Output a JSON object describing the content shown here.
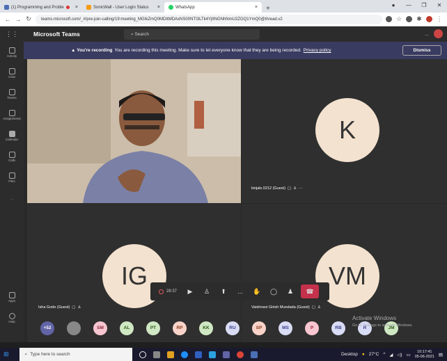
{
  "browser": {
    "tabs": [
      {
        "label": "(1) Programming and Proble",
        "active": false
      },
      {
        "label": "SonicWall - User Login Status",
        "active": false
      },
      {
        "label": "WhatsApp",
        "active": true
      }
    ],
    "new_tab": "+",
    "url": "teams.microsoft.com/_#/pre-join-calling/19:meeting_MGIkZmQ0MDItMDAxNS00NTI3LTk4YjItNGNhNmU2ZGQ1YmQ0@thread.v2"
  },
  "rail": [
    {
      "label": "Activity"
    },
    {
      "label": "Chat"
    },
    {
      "label": "Teams"
    },
    {
      "label": "Assignments"
    },
    {
      "label": "Calendar"
    },
    {
      "label": "Calls"
    },
    {
      "label": "Files"
    },
    {
      "label": "..."
    }
  ],
  "rail_bottom": [
    {
      "label": "Apps"
    },
    {
      "label": "Help"
    }
  ],
  "teams": {
    "title": "Microsoft Teams",
    "search_placeholder": "Search",
    "more": "..."
  },
  "banner": {
    "bold": "You're recording",
    "text": "You are recording this meeting. Make sure to let everyone know that they are being recorded.",
    "link": "Privacy policy",
    "dismiss": "Dismiss"
  },
  "participants": {
    "k": {
      "initials": "K",
      "name": "kinjals.0212 (Guest)"
    },
    "ig": {
      "initials": "IG",
      "name": "Isha Gode (Guest)"
    },
    "vm": {
      "initials": "VM",
      "name": "Vaishnavi Girish Mundada (Guest)"
    }
  },
  "toolbar": {
    "timer": "28:37",
    "more": "..."
  },
  "roster": [
    {
      "initials": "+52",
      "bg": "#6264a7",
      "fg": "#ffffff"
    },
    {
      "initials": "",
      "bg": "#888888",
      "fg": "#ffffff"
    },
    {
      "initials": "SM",
      "bg": "#f7c6d0",
      "fg": "#8a2a3a"
    },
    {
      "initials": "AL",
      "bg": "#cfe8c3",
      "fg": "#2c5a1a"
    },
    {
      "initials": "PT",
      "bg": "#cfe8c3",
      "fg": "#2c5a1a"
    },
    {
      "initials": "RP",
      "bg": "#f9d3c9",
      "fg": "#8a3a1a"
    },
    {
      "initials": "KK",
      "bg": "#cfe8c3",
      "fg": "#2c5a1a"
    },
    {
      "initials": "RU",
      "bg": "#d9dcf5",
      "fg": "#3a3f8a"
    },
    {
      "initials": "SP",
      "bg": "#f9d3c9",
      "fg": "#8a3a1a"
    },
    {
      "initials": "MS",
      "bg": "#d9dcf5",
      "fg": "#3a3f8a"
    },
    {
      "initials": "P",
      "bg": "#f7c6d0",
      "fg": "#8a2a3a"
    },
    {
      "initials": "RB",
      "bg": "#d9dcf5",
      "fg": "#3a3f8a"
    },
    {
      "initials": "R",
      "bg": "#d9dcf5",
      "fg": "#3a3f8a"
    },
    {
      "initials": "JM",
      "bg": "#cfe8c3",
      "fg": "#2c5a1a"
    }
  ],
  "activate": {
    "title": "Activate Windows",
    "sub": "Go to Settings to activate Windows."
  },
  "taskbar": {
    "search": "Type here to search",
    "desktop": "Desktop",
    "weather": "27°C",
    "time": "10:17:41",
    "date": "05-06-2021"
  },
  "colors": {
    "accent": "#6264a7",
    "banner": "#3a3b60",
    "hangup": "#c4314b"
  }
}
